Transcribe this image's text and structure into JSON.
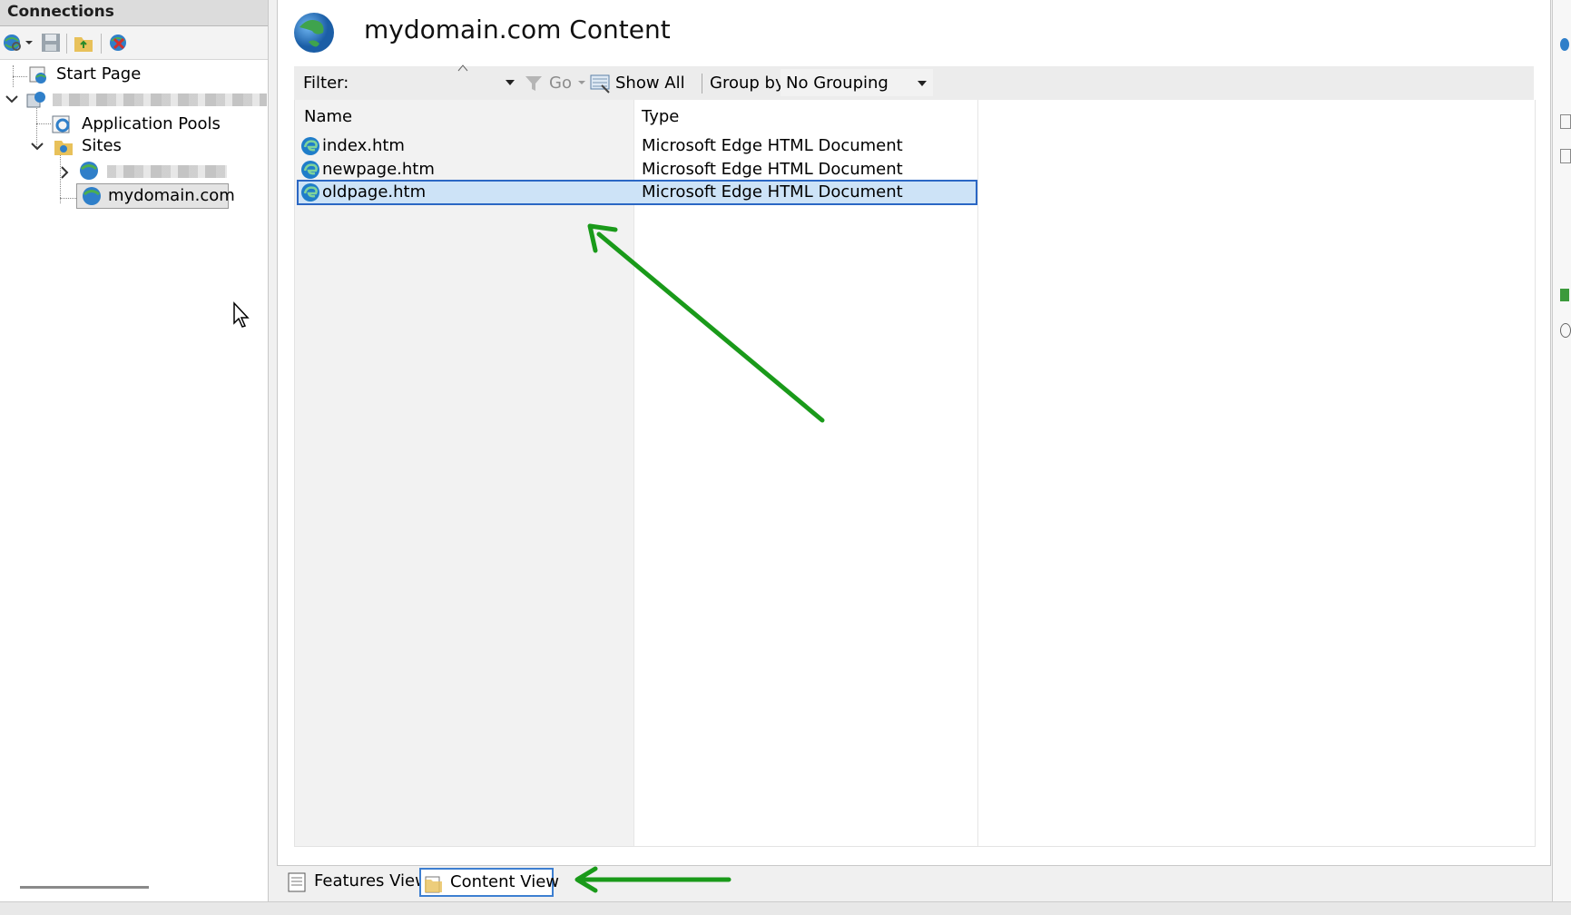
{
  "connections": {
    "title": "Connections",
    "tree": {
      "start_page": "Start Page",
      "app_pools": "Application Pools",
      "sites": "Sites",
      "selected_site": "mydomain.com"
    }
  },
  "main": {
    "title": "mydomain.com Content",
    "filter_label": "Filter:",
    "go_label": "Go",
    "show_all_label": "Show All",
    "group_by_label": "Group by:",
    "group_by_value": "No Grouping",
    "columns": {
      "name": "Name",
      "type": "Type"
    },
    "files": [
      {
        "name": "index.htm",
        "type": "Microsoft Edge HTML Document"
      },
      {
        "name": "newpage.htm",
        "type": "Microsoft Edge HTML Document"
      },
      {
        "name": "oldpage.htm",
        "type": "Microsoft Edge HTML Document",
        "selected": true
      }
    ]
  },
  "tabs": {
    "features_view": "Features View",
    "content_view": "Content View",
    "active": "Content View"
  },
  "colors": {
    "annotation_arrow": "#1a9a1a",
    "selection_fill": "#cde3f7",
    "selection_border": "#2b67c4"
  }
}
